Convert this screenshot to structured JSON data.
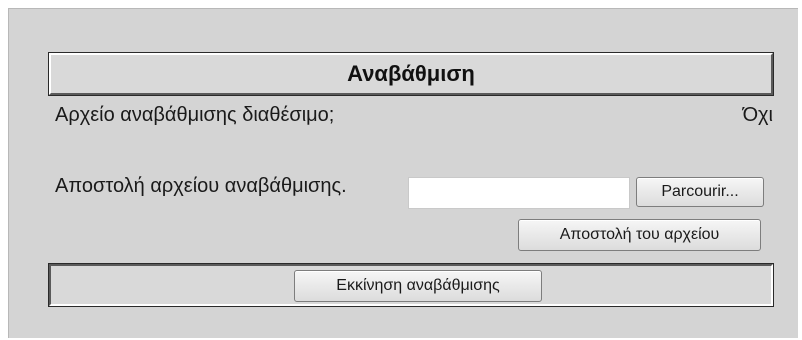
{
  "panel": {
    "title": "Αναβάθμιση"
  },
  "update_available": {
    "label": "Αρχείο αναβάθμισης διαθέσιμο;",
    "value": "Όχι"
  },
  "upload": {
    "label": "Αποστολή αρχείου αναβάθμισης.",
    "file_value": "",
    "browse_label": "Parcourir...",
    "send_label": "Αποστολή του αρχείου"
  },
  "actions": {
    "start_label": "Εκκίνηση αναβάθμισης"
  }
}
